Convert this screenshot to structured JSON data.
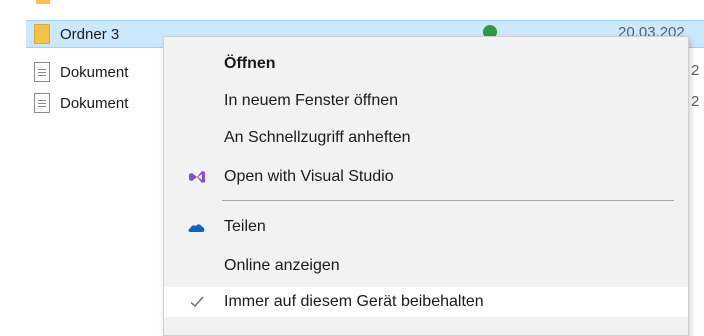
{
  "file_list": {
    "rows": [
      {
        "name": "Ordner 3",
        "date": "20.03.202",
        "type": "folder",
        "selected": true
      },
      {
        "name": "Dokument",
        "fragment": "2",
        "type": "document"
      },
      {
        "name": "Dokument",
        "fragment": "2",
        "type": "document"
      }
    ]
  },
  "context_menu": {
    "items": [
      {
        "label": "Öffnen",
        "bold": true,
        "icon": ""
      },
      {
        "label": "In neuem Fenster öffnen",
        "icon": ""
      },
      {
        "label": "An Schnellzugriff anheften",
        "icon": ""
      },
      {
        "label": "Open with Visual Studio",
        "icon": "visual-studio-icon"
      },
      {
        "label": "Teilen",
        "icon": "onedrive-cloud-icon"
      },
      {
        "label": "Online anzeigen",
        "icon": ""
      },
      {
        "label": "Immer auf diesem Gerät beibehalten",
        "icon": "checkmark-icon",
        "hover": true
      }
    ]
  },
  "colors": {
    "selection": "#cce8ff",
    "menu_background": "#f2f2f2",
    "visual_studio": "#8c4fd1",
    "onedrive": "#0a64c4",
    "sync_ok": "#2e9b3c"
  }
}
